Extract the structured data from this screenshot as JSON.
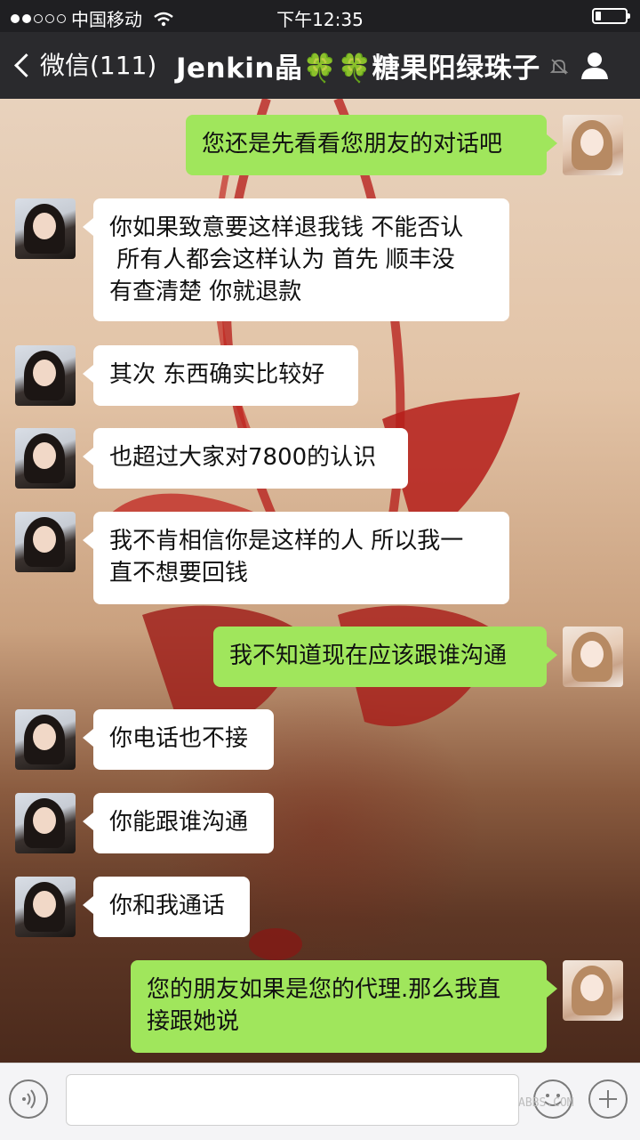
{
  "status_bar": {
    "carrier": "中国移动",
    "time": "下午12:35",
    "icons": [
      "signal-dots-icon",
      "wifi-icon",
      "battery-icon"
    ]
  },
  "nav": {
    "back_label": "微信(111)",
    "title": "Jenkin晶🍀🍀糖果阳绿珠子",
    "icons": [
      "chevron-left-icon",
      "mute-bell-icon",
      "profile-icon"
    ]
  },
  "messages": [
    {
      "side": "right",
      "text": "您还是先看看您朋友的对话吧"
    },
    {
      "side": "left",
      "text": "你如果致意要这样退我钱 不能否认\n 所有人都会这样认为 首先 顺丰没\n有查清楚 你就退款"
    },
    {
      "side": "left",
      "text": "其次 东西确实比较好"
    },
    {
      "side": "left",
      "text": "也超过大家对7800的认识"
    },
    {
      "side": "left",
      "text": "我不肯相信你是这样的人 所以我一\n直不想要回钱"
    },
    {
      "side": "right",
      "text": "我不知道现在应该跟谁沟通"
    },
    {
      "side": "left",
      "text": "你电话也不接"
    },
    {
      "side": "left",
      "text": "你能跟谁沟通"
    },
    {
      "side": "left",
      "text": "你和我通话"
    },
    {
      "side": "right",
      "text": "您的朋友如果是您的代理.那么我直\n接跟她说"
    }
  ],
  "input_bar": {
    "icons": [
      "voice-icon",
      "emoji-icon",
      "plus-icon"
    ],
    "watermark": "ABBS.COM"
  },
  "colors": {
    "sent_bubble": "#a0e65c",
    "received_bubble": "#ffffff",
    "nav_bg": "#2a2a2d"
  }
}
